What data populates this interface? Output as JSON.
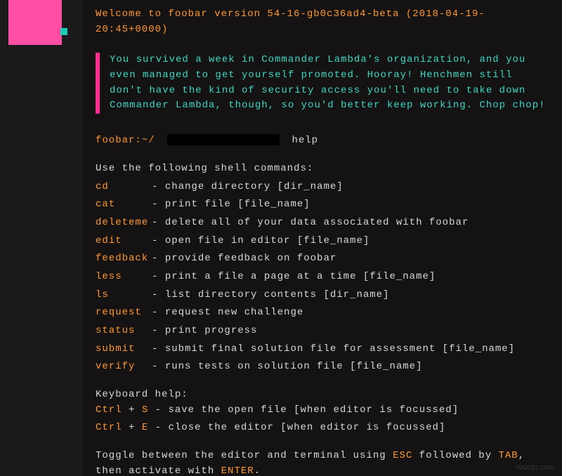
{
  "welcome": "Welcome to foobar version 54-16-gb0c36ad4-beta (2018-04-19-20:45+0000)",
  "story": "You survived a week in Commander Lambda's organization, and you even managed to get yourself promoted. Hooray! Henchmen still don't have the kind of security access you'll need to take down Commander Lambda, though, so you'd better keep working. Chop chop!",
  "prompt": {
    "path": "foobar:~/",
    "command": "help"
  },
  "help": {
    "intro": "Use the following shell commands:",
    "commands": [
      {
        "name": "cd",
        "desc": "change directory [dir_name]"
      },
      {
        "name": "cat",
        "desc": "print file [file_name]"
      },
      {
        "name": "deleteme",
        "desc": "delete all of your data associated with foobar"
      },
      {
        "name": "edit",
        "desc": "open file in editor [file_name]"
      },
      {
        "name": "feedback",
        "desc": "provide feedback on foobar"
      },
      {
        "name": "less",
        "desc": "print a file a page at a time [file_name]"
      },
      {
        "name": "ls",
        "desc": "list directory contents [dir_name]"
      },
      {
        "name": "request",
        "desc": "request new challenge"
      },
      {
        "name": "status",
        "desc": "print progress"
      },
      {
        "name": "submit",
        "desc": "submit final solution file for assessment [file_name]"
      },
      {
        "name": "verify",
        "desc": "runs tests on solution file [file_name]"
      }
    ],
    "keyboard_label": "Keyboard help:",
    "shortcuts": [
      {
        "k1": "Ctrl",
        "plus": " + ",
        "k2": "S",
        "desc": "save the open file [when editor is focussed]"
      },
      {
        "k1": "Ctrl",
        "plus": " + ",
        "k2": "E",
        "desc": "close the editor [when editor is focussed]"
      }
    ],
    "toggle": {
      "t1": "Toggle between the editor and terminal using ",
      "esc": "ESC",
      "t2": " followed by ",
      "tab": "TAB",
      "t3": ", then activate with ",
      "enter": "ENTER",
      "t4": "."
    }
  },
  "watermark": "wsxdn.com"
}
